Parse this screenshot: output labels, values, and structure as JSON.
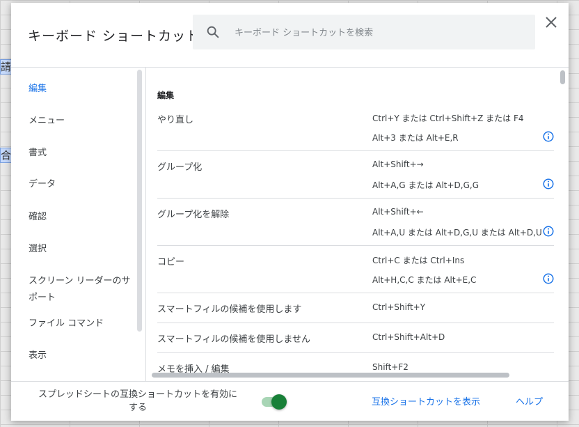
{
  "background": {
    "cell_fragments": [
      "請片",
      "合計"
    ]
  },
  "dialog": {
    "title": "キーボード ショートカット",
    "search": {
      "placeholder": "キーボード ショートカットを検索",
      "value": ""
    }
  },
  "sidebar": {
    "items": [
      {
        "label": "編集",
        "active": true
      },
      {
        "label": "メニュー",
        "active": false
      },
      {
        "label": "書式",
        "active": false
      },
      {
        "label": "データ",
        "active": false
      },
      {
        "label": "確認",
        "active": false
      },
      {
        "label": "選択",
        "active": false
      },
      {
        "label": "スクリーン リーダーのサポート",
        "active": false
      },
      {
        "label": "ファイル コマンド",
        "active": false
      },
      {
        "label": "表示",
        "active": false
      }
    ]
  },
  "content": {
    "section_title": "編集",
    "rows": [
      {
        "action": "やり直し",
        "keys": [
          "Ctrl+Y または Ctrl+Shift+Z または F4",
          "Alt+3 または Alt+E,R"
        ],
        "info": true
      },
      {
        "action": "グループ化",
        "keys": [
          "Alt+Shift+→",
          "Alt+A,G または Alt+D,G,G"
        ],
        "info": true
      },
      {
        "action": "グループ化を解除",
        "keys": [
          "Alt+Shift+←",
          "Alt+A,U または Alt+D,G,U または Alt+D,U"
        ],
        "info": true
      },
      {
        "action": "コピー",
        "keys": [
          "Ctrl+C または Ctrl+Ins",
          "Alt+H,C,C または Alt+E,C"
        ],
        "info": true
      },
      {
        "action": "スマートフィルの候補を使用します",
        "keys": [
          "Ctrl+Shift+Y"
        ],
        "info": false
      },
      {
        "action": "スマートフィルの候補を使用しません",
        "keys": [
          "Ctrl+Shift+Alt+D"
        ],
        "info": false
      },
      {
        "action": "メモを挿入 / 編集",
        "keys": [
          "Shift+F2"
        ],
        "info": false
      }
    ]
  },
  "footer": {
    "compat_label": "スプレッドシートの互換ショートカットを有効にする",
    "toggle_on": true,
    "show_compat_link": "互換ショートカットを表示",
    "help_link": "ヘルプ"
  },
  "colors": {
    "accent": "#1a73e8",
    "toggle_on": "#188038",
    "divider": "#dadce0"
  },
  "icons": {
    "search": "search-icon",
    "close": "close-icon",
    "info": "info-icon"
  }
}
